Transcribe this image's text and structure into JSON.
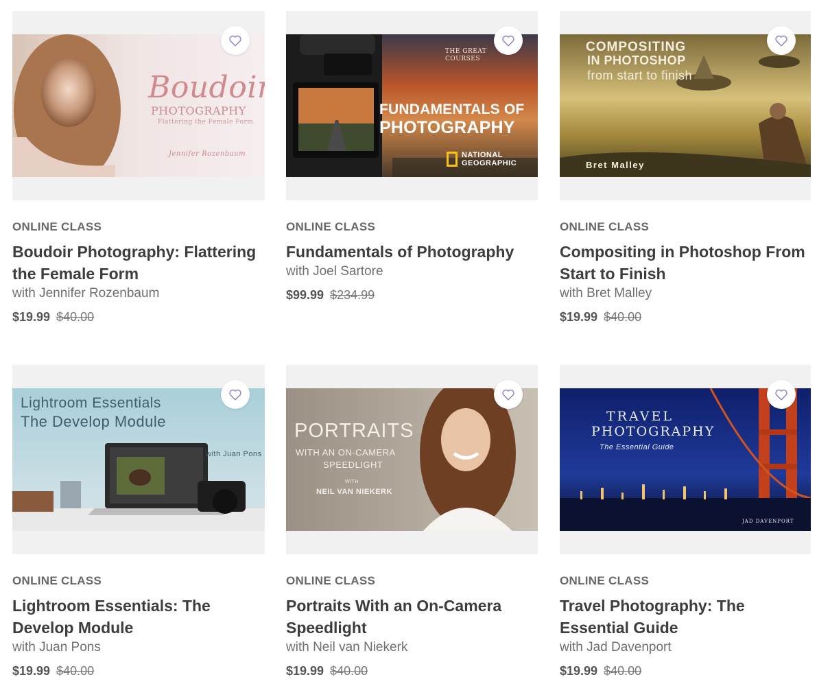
{
  "cards": [
    {
      "kind": "ONLINE CLASS",
      "title": "Boudoir Photography: Flattering the Female Form",
      "author": "with Jennifer Rozenbaum",
      "price": "$19.99",
      "original_price": "$40.00",
      "art": {
        "line1": "Boudoir",
        "line2": "PHOTOGRAPHY",
        "line3": "Flattering the Female Form",
        "line4": "Jennifer Rozenbaum"
      }
    },
    {
      "kind": "ONLINE CLASS",
      "title": "Fundamentals of Photography",
      "author": "with Joel Sartore",
      "price": "$99.99",
      "original_price": "$234.99",
      "art": {
        "line1": "FUNDAMENTALS OF",
        "line2": "PHOTOGRAPHY",
        "line3": "THE GREAT COURSES",
        "line4": "NATIONAL GEOGRAPHIC"
      }
    },
    {
      "kind": "ONLINE CLASS",
      "title": "Compositing in Photoshop From Start to Finish",
      "author": "with Bret Malley",
      "price": "$19.99",
      "original_price": "$40.00",
      "art": {
        "line1": "COMPOSITING",
        "line2": "IN PHOTOSHOP",
        "line3": "from start to finish",
        "line4": "Bret Malley"
      }
    },
    {
      "kind": "ONLINE CLASS",
      "title": "Lightroom Essentials: The Develop Module",
      "author": "with Juan Pons",
      "price": "$19.99",
      "original_price": "$40.00",
      "art": {
        "line1": "Lightroom Essentials",
        "line2": "The Develop Module",
        "line3": "with Juan Pons"
      }
    },
    {
      "kind": "ONLINE CLASS",
      "title": "Portraits With an On-Camera Speedlight",
      "author": "with Neil van Niekerk",
      "price": "$19.99",
      "original_price": "$40.00",
      "art": {
        "line1": "PORTRAITS",
        "line2": "WITH AN ON-CAMERA",
        "line3": "SPEEDLIGHT",
        "line4": "WITH",
        "line5": "NEIL VAN NIEKERK"
      }
    },
    {
      "kind": "ONLINE CLASS",
      "title": "Travel Photography: The Essential Guide",
      "author": "with Jad Davenport",
      "price": "$19.99",
      "original_price": "$40.00",
      "art": {
        "line1": "TRAVEL",
        "line2": "PHOTOGRAPHY",
        "line3": "The Essential Guide",
        "line4": "JAD DAVENPORT"
      }
    }
  ],
  "colors": {
    "heart": "#8b86c9",
    "thumb_bg": "#f1f1f1"
  }
}
